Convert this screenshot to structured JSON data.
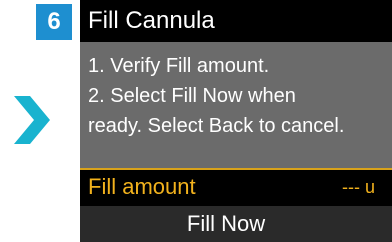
{
  "step": {
    "number": "6"
  },
  "screen": {
    "title": "Fill Cannula",
    "instructions": [
      "1. Verify Fill amount.",
      "2. Select Fill Now when",
      "ready. Select Back to cancel."
    ],
    "fill_amount": {
      "label": "Fill amount",
      "value": "--- u"
    },
    "fill_now_label": "Fill Now"
  },
  "colors": {
    "step_badge": "#1e8fd0",
    "arrow": "#19b3cf",
    "highlight_text": "#f2b21d",
    "message_background": "#6b6b6b"
  },
  "icons": {
    "arrow": "chevron-right-icon"
  }
}
